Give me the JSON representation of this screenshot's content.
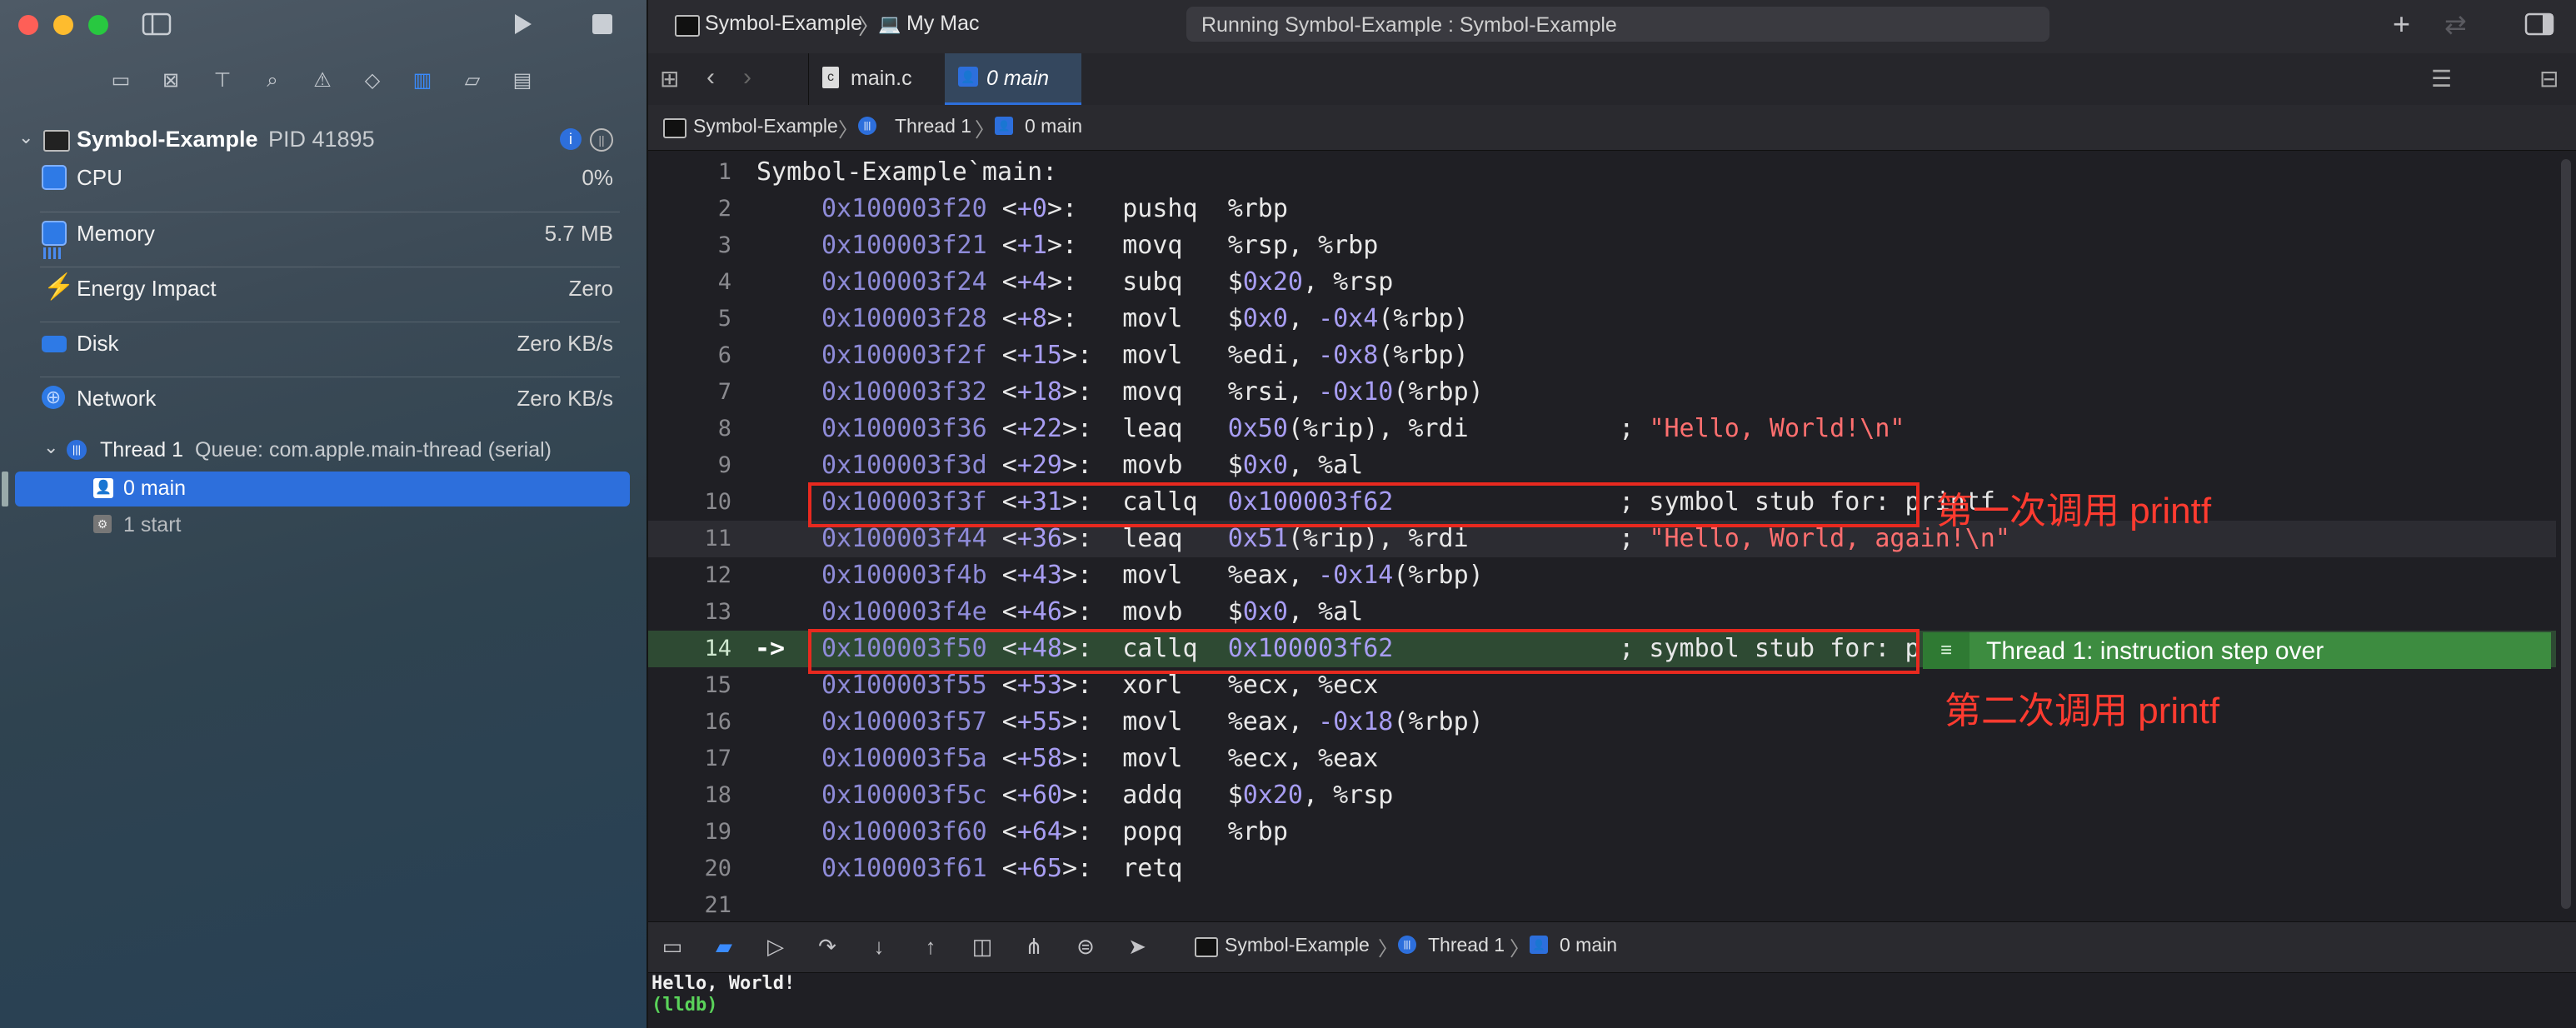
{
  "sidebar": {
    "process": {
      "name": "Symbol-Example",
      "pid": "PID 41895"
    },
    "metrics": [
      {
        "label": "CPU",
        "value": "0%"
      },
      {
        "label": "Memory",
        "value": "5.7 MB"
      },
      {
        "label": "Energy Impact",
        "value": "Zero"
      },
      {
        "label": "Disk",
        "value": "Zero KB/s"
      },
      {
        "label": "Network",
        "value": "Zero KB/s"
      }
    ],
    "thread": {
      "name": "Thread 1",
      "queue": "Queue: com.apple.main-thread (serial)"
    },
    "frames": [
      {
        "label": "0 main"
      },
      {
        "label": "1 start"
      }
    ]
  },
  "titlebar": {
    "scheme": "Symbol-Example",
    "destination": "My Mac",
    "status": "Running Symbol-Example : Symbol-Example"
  },
  "tabs": [
    {
      "label": "main.c"
    },
    {
      "label": "0 main"
    }
  ],
  "jumpbar": {
    "items": [
      "Symbol-Example",
      "Thread 1",
      "0 main"
    ]
  },
  "code": {
    "header": "Symbol-Example`main:",
    "lines": [
      {
        "addr": "0x100003f20",
        "off": "+0",
        "op": "pushq",
        "args": [
          [
            "%rbp",
            ""
          ]
        ]
      },
      {
        "addr": "0x100003f21",
        "off": "+1",
        "op": "movq",
        "args": [
          [
            "%rsp, %rbp",
            ""
          ]
        ]
      },
      {
        "addr": "0x100003f24",
        "off": "+4",
        "op": "subq",
        "args": [
          [
            "$",
            ""
          ],
          [
            "0x20",
            "num"
          ],
          [
            ", %rsp",
            ""
          ]
        ]
      },
      {
        "addr": "0x100003f28",
        "off": "+8",
        "op": "movl",
        "args": [
          [
            "$",
            ""
          ],
          [
            "0x0",
            "num"
          ],
          [
            ", ",
            ""
          ],
          [
            "-0x4",
            "num"
          ],
          [
            "(%rbp)",
            ""
          ]
        ]
      },
      {
        "addr": "0x100003f2f",
        "off": "+15",
        "op": "movl",
        "args": [
          [
            "%edi, ",
            ""
          ],
          [
            "-0x8",
            "num"
          ],
          [
            "(%rbp)",
            ""
          ]
        ]
      },
      {
        "addr": "0x100003f32",
        "off": "+18",
        "op": "movq",
        "args": [
          [
            "%rsi, ",
            ""
          ],
          [
            "-0x10",
            "num"
          ],
          [
            "(%rbp)",
            ""
          ]
        ]
      },
      {
        "addr": "0x100003f36",
        "off": "+22",
        "op": "leaq",
        "args": [
          [
            "0x50",
            "num"
          ],
          [
            "(%rip), %rdi",
            ""
          ]
        ],
        "comment": "\"Hello, World!\\n\"",
        "ctype": "str"
      },
      {
        "addr": "0x100003f3d",
        "off": "+29",
        "op": "movb",
        "args": [
          [
            "$",
            ""
          ],
          [
            "0x0",
            "num"
          ],
          [
            ", %al",
            ""
          ]
        ]
      },
      {
        "addr": "0x100003f3f",
        "off": "+31",
        "op": "callq",
        "args": [
          [
            "0x100003f62",
            "num"
          ]
        ],
        "comment": "symbol stub for: printf",
        "ctype": "plain"
      },
      {
        "addr": "0x100003f44",
        "off": "+36",
        "op": "leaq",
        "args": [
          [
            "0x51",
            "num"
          ],
          [
            "(%rip), %rdi",
            ""
          ]
        ],
        "comment": "\"Hello, World, again!\\n\"",
        "ctype": "str"
      },
      {
        "addr": "0x100003f4b",
        "off": "+43",
        "op": "movl",
        "args": [
          [
            "%eax, ",
            ""
          ],
          [
            "-0x14",
            "num"
          ],
          [
            "(%rbp)",
            ""
          ]
        ]
      },
      {
        "addr": "0x100003f4e",
        "off": "+46",
        "op": "movb",
        "args": [
          [
            "$",
            ""
          ],
          [
            "0x0",
            "num"
          ],
          [
            ", %al",
            ""
          ]
        ]
      },
      {
        "addr": "0x100003f50",
        "off": "+48",
        "op": "callq",
        "args": [
          [
            "0x100003f62",
            "num"
          ]
        ],
        "comment": "symbol stub for: printf",
        "ctype": "plain"
      },
      {
        "addr": "0x100003f55",
        "off": "+53",
        "op": "xorl",
        "args": [
          [
            "%ecx, %ecx",
            ""
          ]
        ]
      },
      {
        "addr": "0x100003f57",
        "off": "+55",
        "op": "movl",
        "args": [
          [
            "%eax, ",
            ""
          ],
          [
            "-0x18",
            "num"
          ],
          [
            "(%rbp)",
            ""
          ]
        ]
      },
      {
        "addr": "0x100003f5a",
        "off": "+58",
        "op": "movl",
        "args": [
          [
            "%ecx, %eax",
            ""
          ]
        ]
      },
      {
        "addr": "0x100003f5c",
        "off": "+60",
        "op": "addq",
        "args": [
          [
            "$",
            ""
          ],
          [
            "0x20",
            "num"
          ],
          [
            ", %rsp",
            ""
          ]
        ]
      },
      {
        "addr": "0x100003f60",
        "off": "+64",
        "op": "popq",
        "args": [
          [
            "%rbp",
            ""
          ]
        ]
      },
      {
        "addr": "0x100003f61",
        "off": "+65",
        "op": "retq",
        "args": []
      }
    ],
    "line_numbers": [
      "1",
      "2",
      "3",
      "4",
      "5",
      "6",
      "7",
      "8",
      "9",
      "10",
      "11",
      "12",
      "13",
      "14",
      "15",
      "16",
      "17",
      "18",
      "19",
      "20",
      "21"
    ],
    "pc_arrow": "->",
    "current_line": 14,
    "highlight_line": 11,
    "annotation_first": "第一次调用 printf",
    "annotation_second": "第二次调用 printf",
    "instruction_banner": "Thread 1: instruction step over"
  },
  "debugbar": {
    "items": [
      "Symbol-Example",
      "Thread 1",
      "0 main"
    ]
  },
  "console": {
    "output": "Hello, World!",
    "prompt": "(lldb)"
  },
  "colors": {
    "accent_blue": "#2d6fdc",
    "current_line_bg": "#2e4a33",
    "banner_green": "#3d8c40",
    "annotation_red": "#ff3b30"
  }
}
